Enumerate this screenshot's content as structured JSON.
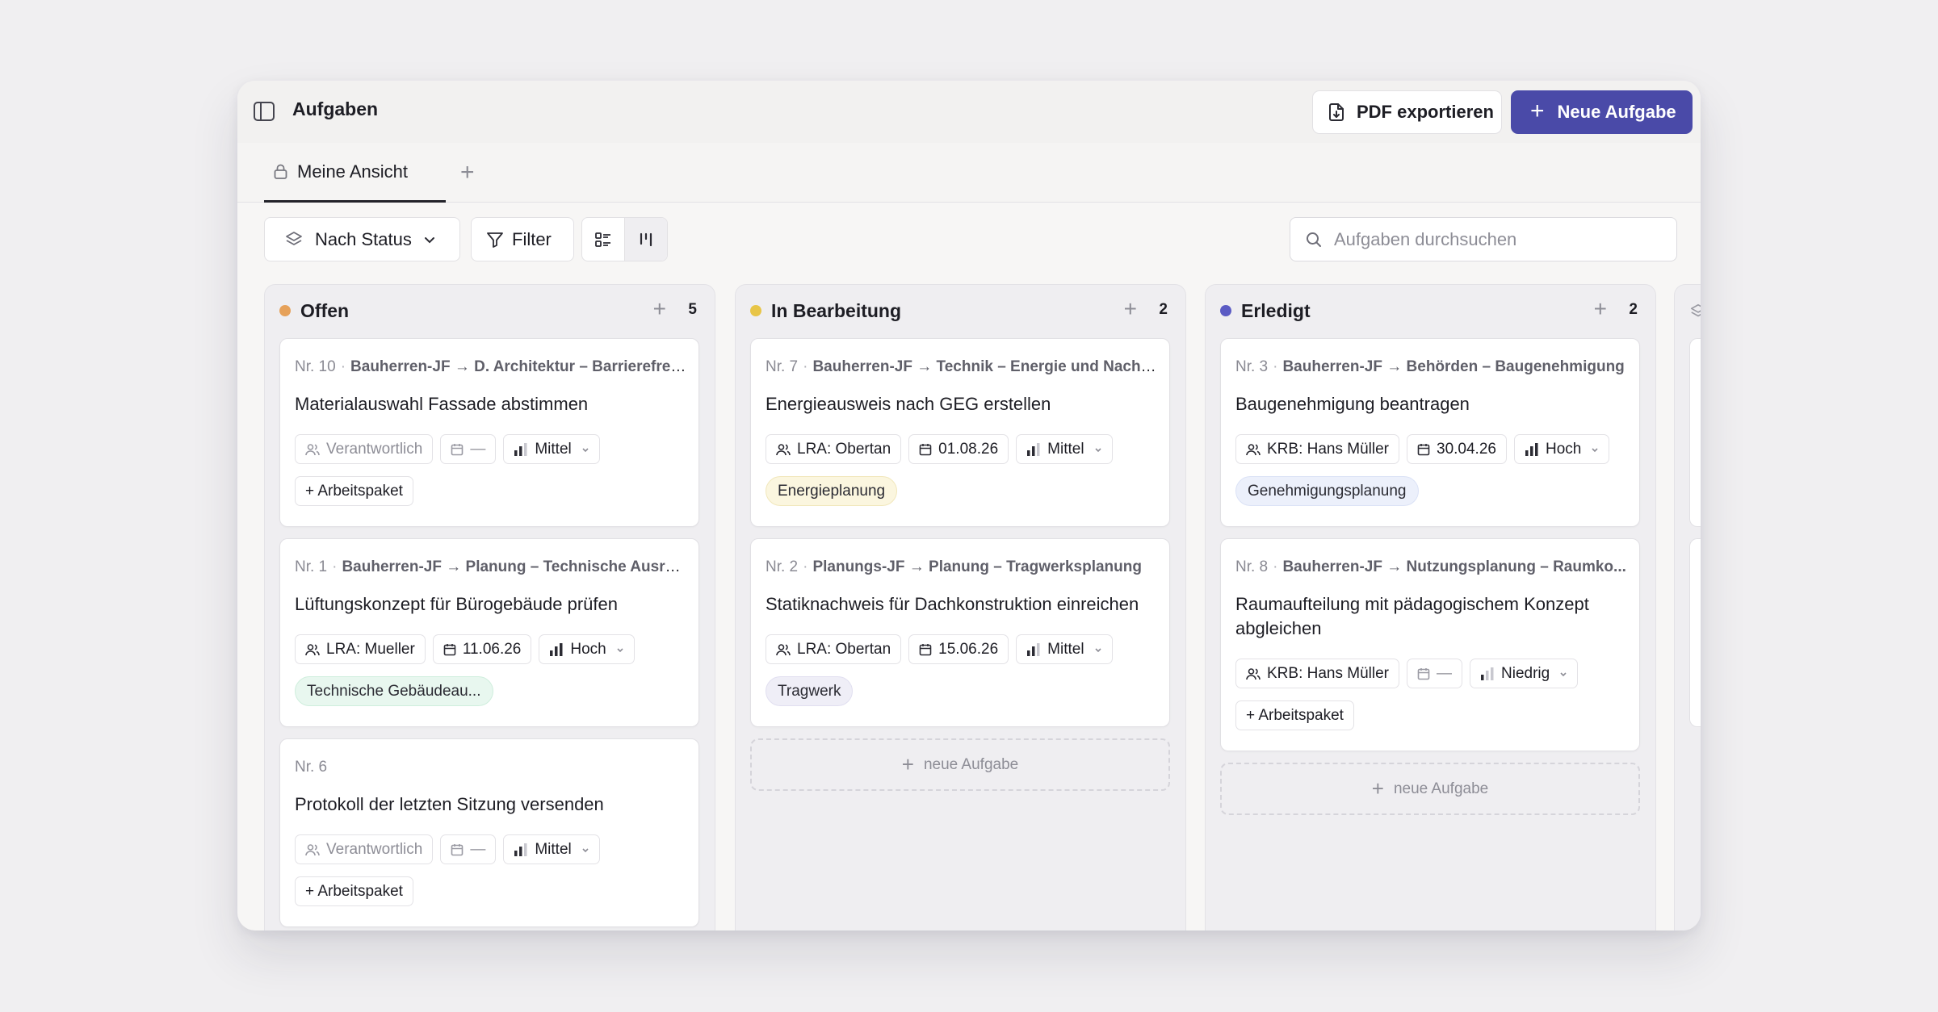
{
  "app": {
    "title": "Aufgaben",
    "export_label": "PDF exportieren",
    "new_task_label": "Neue Aufgabe",
    "accent_color": "#4a4aa8"
  },
  "tabs": [
    {
      "label": "Meine Ansicht",
      "icon": "lock-icon",
      "active": true
    }
  ],
  "toolbar": {
    "group_label": "Nach Status",
    "filter_label": "Filter",
    "view_modes": [
      "list-view-icon",
      "board-view-icon"
    ],
    "active_view": "board-view-icon",
    "search_placeholder": "Aufgaben durchsuchen"
  },
  "columns": [
    {
      "title": "Offen",
      "count": "5",
      "color": "#e6a15a",
      "cards": [
        {
          "nr": "Nr. 10",
          "path": "Bauherren-JF → D. Architektur – Barrierefrei...",
          "title": "Materialauswahl Fassade abstimmen",
          "assignee": "Verantwortlich",
          "date": "—",
          "priority": "Mittel",
          "tag": null,
          "work_package": "+ Arbeitspaket"
        },
        {
          "nr": "Nr. 1",
          "path": "Bauherren-JF → Planung – Technische Ausrü...",
          "title": "Lüftungskonzept für Bürogebäude prüfen",
          "assignee": "LRA: Mueller",
          "date": "11.06.26",
          "priority": "Hoch",
          "tag": "Technische Gebäudeau...",
          "work_package": null
        },
        {
          "nr": "Nr. 6",
          "path": "",
          "title": "Protokoll der letzten Sitzung versenden",
          "assignee": "Verantwortlich",
          "date": "—",
          "priority": "Mittel",
          "tag": null,
          "work_package": "+ Arbeitspaket"
        }
      ]
    },
    {
      "title": "In Bearbeitung",
      "count": "2",
      "color": "#e8c547",
      "cards": [
        {
          "nr": "Nr. 7",
          "path": "Bauherren-JF → Technik – Energie und Nachh...",
          "title": "Energieausweis nach GEG erstellen",
          "assignee": "LRA: Obertan",
          "date": "01.08.26",
          "priority": "Mittel",
          "tag": "Energieplanung",
          "work_package": null
        },
        {
          "nr": "Nr. 2",
          "path": "Planungs-JF → Planung – Tragwerksplanung",
          "title": "Statiknachweis für Dachkonstruktion einreichen",
          "assignee": "LRA: Obertan",
          "date": "15.06.26",
          "priority": "Mittel",
          "tag": "Tragwerk",
          "work_package": null
        }
      ],
      "add_label": "neue Aufgabe"
    },
    {
      "title": "Erledigt",
      "count": "2",
      "color": "#5b5bc4",
      "cards": [
        {
          "nr": "Nr. 3",
          "path": "Bauherren-JF → Behörden – Baugenehmigung",
          "title": "Baugenehmigung beantragen",
          "assignee": "KRB: Hans Müller",
          "date": "30.04.26",
          "priority": "Hoch",
          "tag": "Genehmigungsplanung",
          "work_package": null
        },
        {
          "nr": "Nr. 8",
          "path": "Bauherren-JF → Nutzungsplanung – Raumko...",
          "title": "Raumaufteilung mit pädagogischem Konzept abgleichen",
          "assignee": "KRB: Hans Müller",
          "date": "—",
          "priority": "Niedrig",
          "tag": null,
          "work_package": "+ Arbeitspaket"
        }
      ],
      "add_label": "neue Aufgabe"
    }
  ]
}
